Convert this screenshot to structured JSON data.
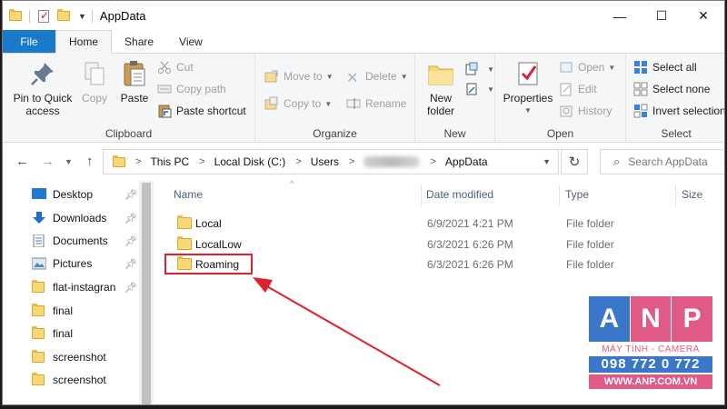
{
  "window": {
    "title": "AppData",
    "minimize_glyph": "—",
    "maximize_glyph": "☐",
    "close_glyph": "✕"
  },
  "qat": {
    "dropdown_glyph": "▼"
  },
  "tabs": [
    {
      "label": "File"
    },
    {
      "label": "Home"
    },
    {
      "label": "Share"
    },
    {
      "label": "View"
    }
  ],
  "ribbon": {
    "clipboard": {
      "label": "Clipboard",
      "pin": "Pin to Quick access",
      "pin_line1": "Pin to Quick",
      "pin_line2": "access",
      "copy": "Copy",
      "paste": "Paste",
      "cut": "Cut",
      "copy_path": "Copy path",
      "paste_shortcut": "Paste shortcut"
    },
    "organize": {
      "label": "Organize",
      "move_to": "Move to",
      "copy_to": "Copy to",
      "delete": "Delete",
      "rename": "Rename"
    },
    "new": {
      "label": "New",
      "new_folder_line1": "New",
      "new_folder_line2": "folder"
    },
    "open": {
      "label": "Open",
      "properties": "Properties",
      "open": "Open",
      "edit": "Edit",
      "history": "History"
    },
    "select": {
      "label": "Select",
      "select_all": "Select all",
      "select_none": "Select none",
      "invert": "Invert selection"
    }
  },
  "address": {
    "crumbs": [
      "This PC",
      "Local Disk (C:)",
      "Users",
      "AppData"
    ],
    "search_placeholder": "Search AppData"
  },
  "nav_pane": {
    "items": [
      {
        "label": "Desktop",
        "icon": "desktop-icon",
        "pinned": true
      },
      {
        "label": "Downloads",
        "icon": "download-icon",
        "pinned": true
      },
      {
        "label": "Documents",
        "icon": "documents-icon",
        "pinned": true
      },
      {
        "label": "Pictures",
        "icon": "pictures-icon",
        "pinned": true
      },
      {
        "label": "flat-instagran",
        "icon": "folder-icon",
        "pinned": true
      },
      {
        "label": "final",
        "icon": "folder-icon",
        "pinned": false
      },
      {
        "label": "final",
        "icon": "folder-icon",
        "pinned": false
      },
      {
        "label": "screenshot",
        "icon": "folder-icon",
        "pinned": false
      },
      {
        "label": "screenshot",
        "icon": "folder-icon",
        "pinned": false
      }
    ]
  },
  "file_list": {
    "columns": {
      "name": "Name",
      "date": "Date modified",
      "type": "Type",
      "size": "Size"
    },
    "rows": [
      {
        "name": "Local",
        "date": "6/9/2021 4:21 PM",
        "type": "File folder"
      },
      {
        "name": "LocalLow",
        "date": "6/3/2021 6:26 PM",
        "type": "File folder"
      },
      {
        "name": "Roaming",
        "date": "6/3/2021 6:26 PM",
        "type": "File folder"
      }
    ]
  },
  "watermark": {
    "letters": [
      "A",
      "N",
      "P"
    ],
    "tile_colors": [
      "#3b77c9",
      "#e05a86",
      "#e05a86"
    ],
    "tagline": "MÁY TÍNH - CAMERA",
    "phone": "098 772 0 772",
    "website": "WWW.ANP.COM.VN"
  },
  "colors": {
    "file_tab": "#1979ca",
    "annotation": "#e0202a"
  }
}
